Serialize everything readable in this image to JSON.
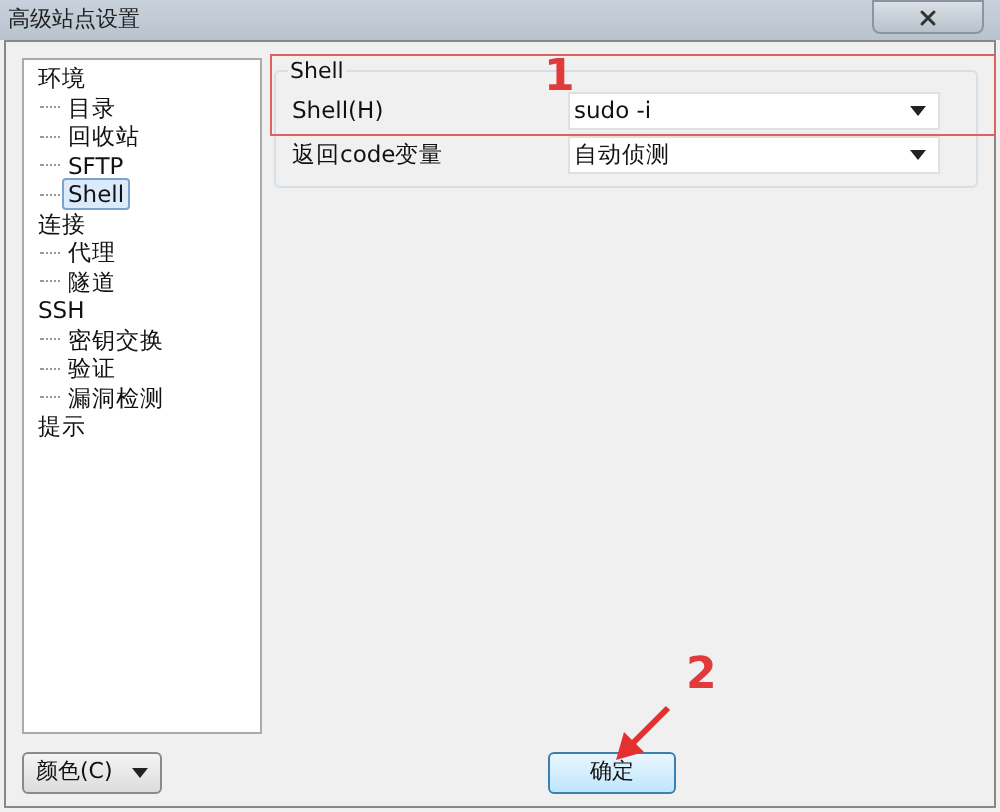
{
  "window": {
    "title": "高级站点设置"
  },
  "tree": [
    {
      "label": "环境",
      "selected": false,
      "children": [
        {
          "label": "目录",
          "selected": false
        },
        {
          "label": "回收站",
          "selected": false
        },
        {
          "label": "SFTP",
          "selected": false
        },
        {
          "label": "Shell",
          "selected": true
        }
      ]
    },
    {
      "label": "连接",
      "selected": false,
      "children": [
        {
          "label": "代理",
          "selected": false
        },
        {
          "label": "隧道",
          "selected": false
        }
      ]
    },
    {
      "label": "SSH",
      "selected": false,
      "children": [
        {
          "label": "密钥交换",
          "selected": false
        },
        {
          "label": "验证",
          "selected": false
        },
        {
          "label": "漏洞检测",
          "selected": false
        }
      ]
    },
    {
      "label": "提示",
      "selected": false
    }
  ],
  "group": {
    "title": "Shell",
    "rows": [
      {
        "label": "Shell(H)",
        "value": "sudo -i"
      },
      {
        "label": "返回code变量",
        "value": "自动侦测"
      }
    ]
  },
  "buttons": {
    "palette": "颜色(C)",
    "ok": "确定"
  },
  "annotations": [
    "1",
    "2"
  ]
}
